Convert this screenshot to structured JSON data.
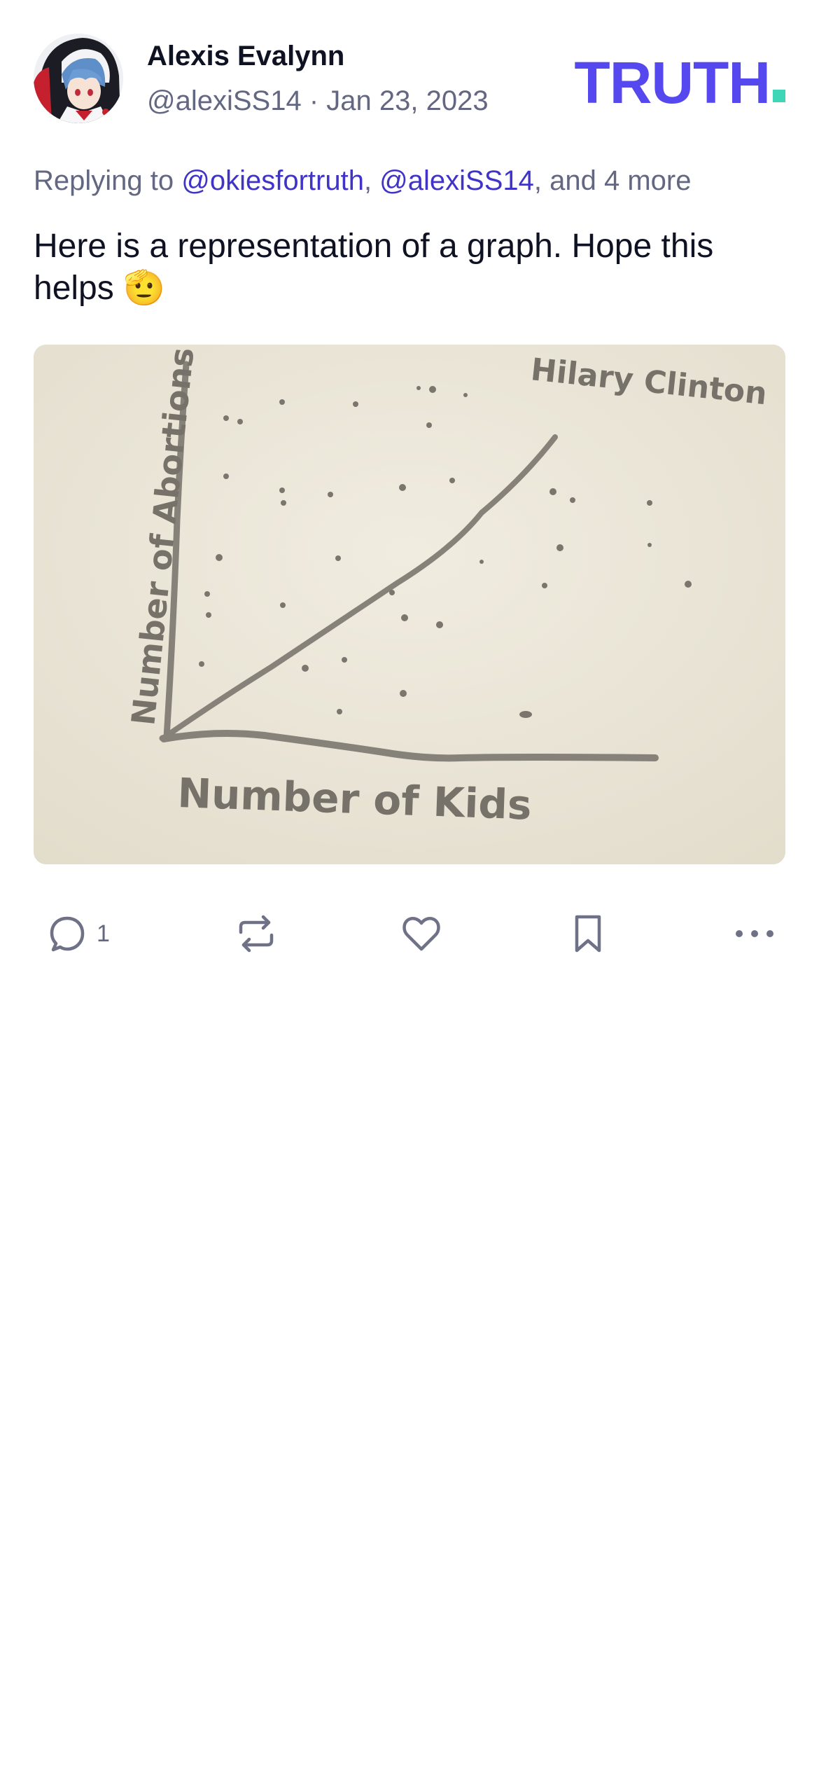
{
  "post": {
    "author_name": "Alexis Evalynn",
    "handle": "@alexiSS14",
    "separator": " · ",
    "date": "Jan 23, 2023",
    "replying_prefix": "Replying to ",
    "mention_1": "@okiesfortruth",
    "comma": ", ",
    "mention_2": "@alexiSS14",
    "replying_suffix": ", and 4 more",
    "text": "Here is a representation of a graph. Hope this helps 🫡",
    "image_labels": {
      "y_axis": "Number of Abortions",
      "x_axis": "Number of Kids",
      "line": "Hilary Clinton"
    }
  },
  "brand": {
    "name": "TRUTH",
    "primary_color": "#5448ee",
    "accent_color": "#3fd6b8"
  },
  "actions": {
    "reply_icon": "reply-icon",
    "reply_count": "1",
    "repost_icon": "repost-icon",
    "like_icon": "heart-icon",
    "bookmark_icon": "bookmark-icon",
    "more_icon": "more-icon"
  }
}
